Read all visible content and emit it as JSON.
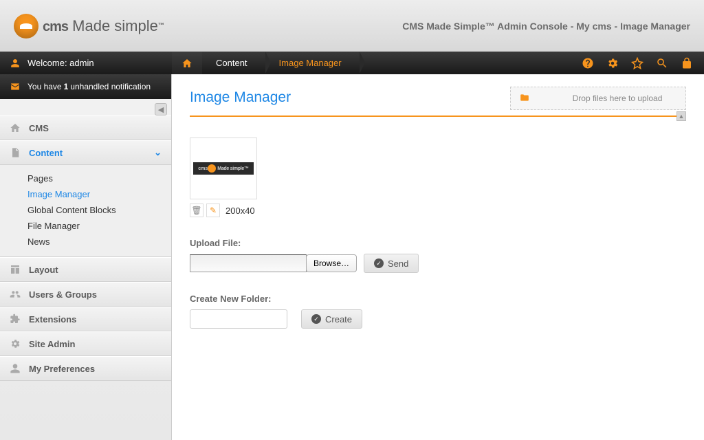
{
  "header": {
    "logo_cms": "cms",
    "logo_made": " Made ",
    "logo_simple": "simple",
    "trademark": "™",
    "right": "CMS Made Simple™ Admin Console - My cms - Image Manager"
  },
  "welcome": {
    "label": "Welcome: admin"
  },
  "notification": {
    "pre": "You have ",
    "count": "1",
    "post": " unhandled notification"
  },
  "breadcrumb": {
    "content": "Content",
    "page": "Image Manager"
  },
  "toolbar_icons": [
    "help",
    "settings",
    "favorite",
    "search",
    "lock"
  ],
  "sidebar": {
    "sections": [
      {
        "label": "CMS"
      },
      {
        "label": "Content"
      },
      {
        "label": "Layout"
      },
      {
        "label": "Users & Groups"
      },
      {
        "label": "Extensions"
      },
      {
        "label": "Site Admin"
      },
      {
        "label": "My Preferences"
      }
    ],
    "content_items": [
      {
        "label": "Pages"
      },
      {
        "label": "Image Manager"
      },
      {
        "label": "Global Content Blocks"
      },
      {
        "label": "File Manager"
      },
      {
        "label": "News"
      }
    ]
  },
  "page": {
    "title": "Image Manager",
    "drop_label": "Drop files here to upload",
    "thumb_name": "200x40",
    "upload_label": "Upload File:",
    "browse_btn": "Browse…",
    "send_btn": "Send",
    "create_folder_label": "Create New Folder:",
    "create_btn": "Create"
  }
}
